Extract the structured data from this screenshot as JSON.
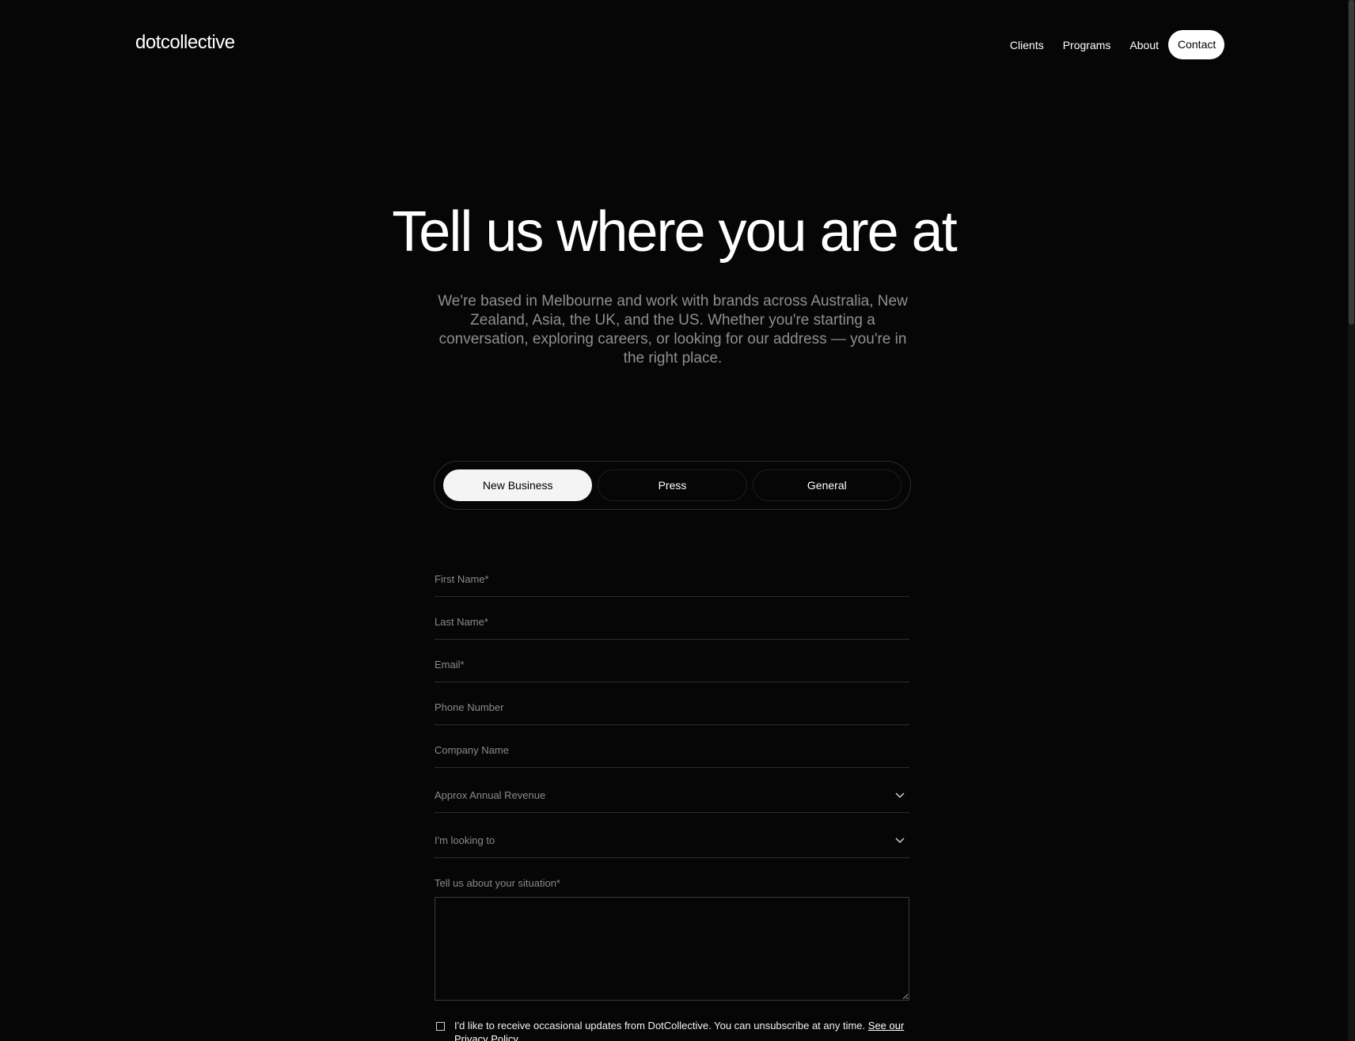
{
  "header": {
    "logo": "dotcollective",
    "nav": {
      "clients": "Clients",
      "programs": "Programs",
      "about": "About",
      "contact": "Contact"
    }
  },
  "hero": {
    "title": "Tell us where you are at",
    "subtitle": "We're based in Melbourne and work with brands across Australia, New Zealand, Asia, the UK, and the US. Whether you're starting a conversation, exploring careers, or looking for our address — you're in the right place."
  },
  "tabs": {
    "new_business": "New Business",
    "press": "Press",
    "general": "General",
    "active": "New Business"
  },
  "form": {
    "first_name": "First Name*",
    "last_name": "Last Name*",
    "email": "Email*",
    "phone": "Phone Number",
    "company": "Company Name",
    "revenue": "Approx Annual Revenue",
    "looking_to": "I'm looking to",
    "situation_label": "Tell us about your situation*",
    "consent_text": "I'd like to receive occasional updates from DotCollective. You can unsubscribe at any time.",
    "consent_link": "See our Privacy Policy."
  },
  "icons": {
    "select_chevron": "chevron-down-icon",
    "checkbox": "checkbox-icon"
  },
  "colors": {
    "background": "#060606",
    "text": "#f2f2f2",
    "muted": "#8a8a8a",
    "active_tab": "#f4f4f4"
  }
}
